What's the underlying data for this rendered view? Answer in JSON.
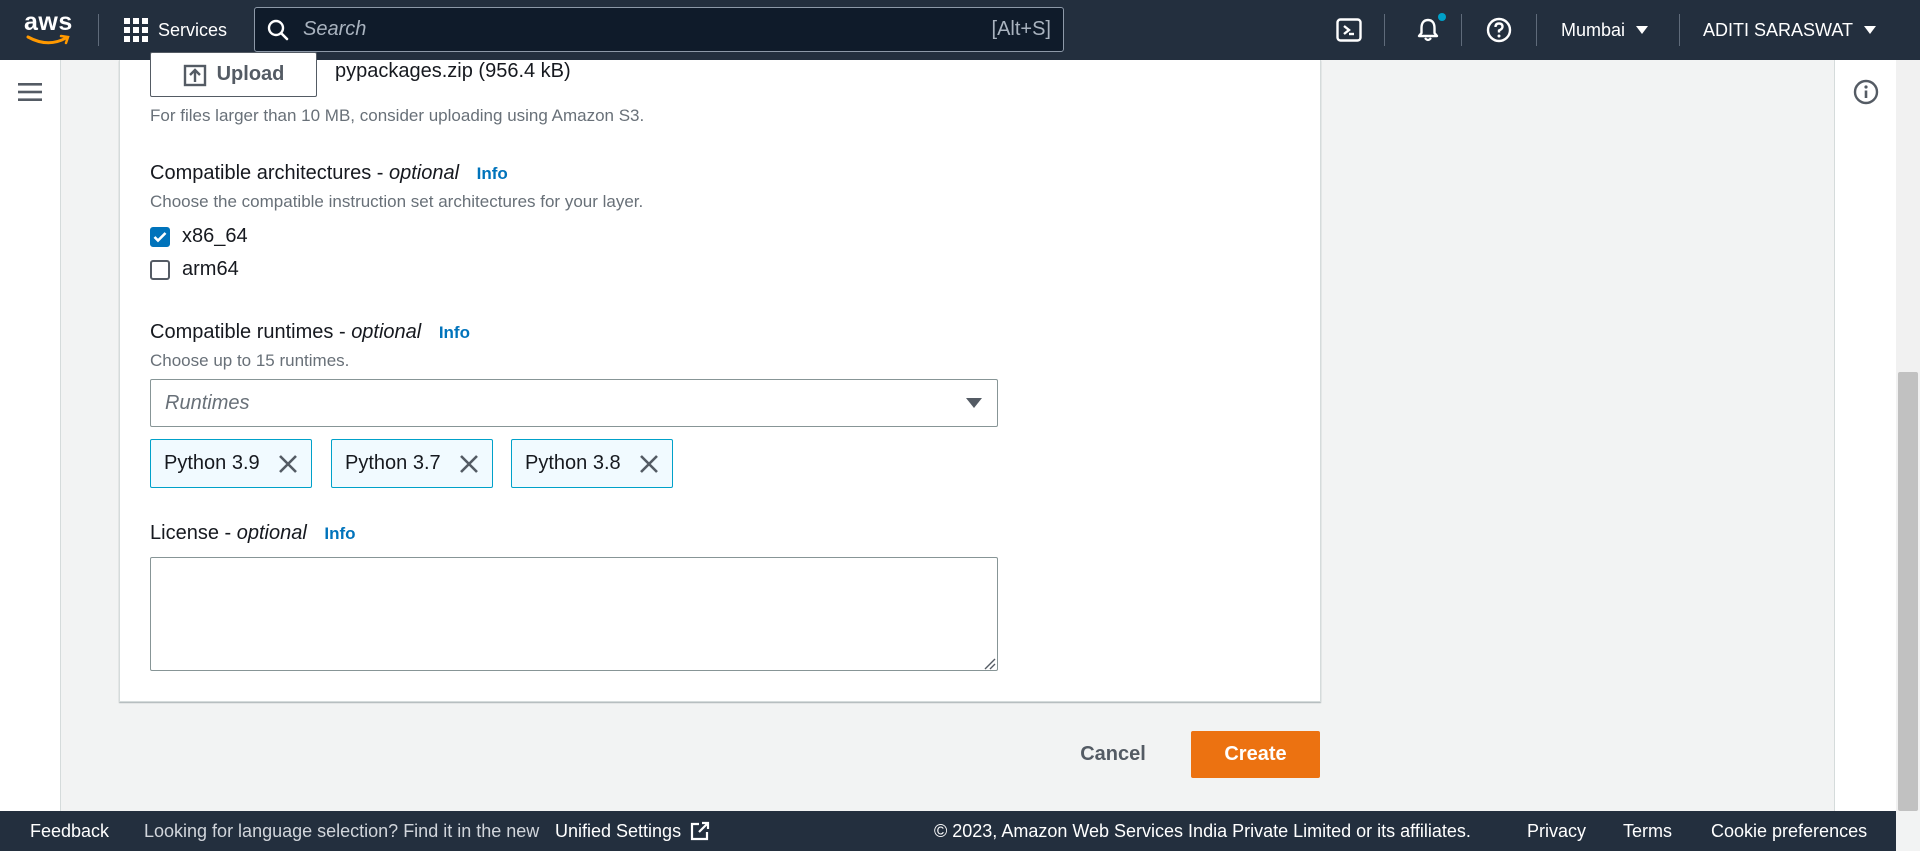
{
  "topnav": {
    "logo_text": "aws",
    "services_label": "Services",
    "search_placeholder": "Search",
    "search_shortcut": "[Alt+S]",
    "region": "Mumbai",
    "account": "ADITI SARASWAT"
  },
  "form": {
    "upload_label": "Upload",
    "file_name": "pypackages.zip (956.4 kB)",
    "file_hint": "For files larger than 10 MB, consider uploading using Amazon S3.",
    "architectures": {
      "label": "Compatible architectures - ",
      "optional": "optional",
      "info": "Info",
      "description": "Choose the compatible instruction set architectures for your layer.",
      "options": [
        {
          "label": "x86_64",
          "checked": true
        },
        {
          "label": "arm64",
          "checked": false
        }
      ]
    },
    "runtimes": {
      "label": "Compatible runtimes - ",
      "optional": "optional",
      "info": "Info",
      "description": "Choose up to 15 runtimes.",
      "placeholder": "Runtimes",
      "selected": [
        "Python 3.9",
        "Python 3.7",
        "Python 3.8"
      ]
    },
    "license": {
      "label": "License - ",
      "optional": "optional",
      "info": "Info",
      "value": ""
    }
  },
  "actions": {
    "cancel": "Cancel",
    "create": "Create",
    "create_color": "#ec7211"
  },
  "footer": {
    "feedback": "Feedback",
    "language_prompt": "Looking for language selection? Find it in the new",
    "unified_settings": "Unified Settings",
    "copyright": "© 2023, Amazon Web Services India Private Limited or its affiliates.",
    "privacy": "Privacy",
    "terms": "Terms",
    "cookies": "Cookie preferences"
  }
}
